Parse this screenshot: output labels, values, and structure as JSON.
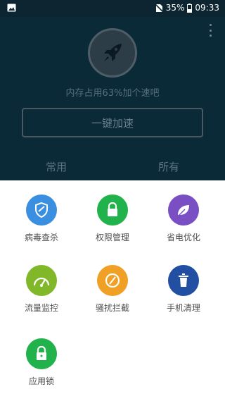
{
  "status_bar": {
    "battery": "35%",
    "time": "09:33"
  },
  "booster": {
    "memory_text": "内存占用63%加个速吧",
    "accelerate_button": "一键加速"
  },
  "tabs": {
    "common": "常用",
    "all": "所有"
  },
  "apps": [
    {
      "label": "病毒查杀",
      "color": "#3b8fe0"
    },
    {
      "label": "权限管理",
      "color": "#21b24b"
    },
    {
      "label": "省电优化",
      "color": "#7a4fc4"
    },
    {
      "label": "流量监控",
      "color": "#80b82a"
    },
    {
      "label": "骚扰拦截",
      "color": "#f0a024"
    },
    {
      "label": "手机清理",
      "color": "#234fa3"
    },
    {
      "label": "应用锁",
      "color": "#21b24b"
    }
  ]
}
